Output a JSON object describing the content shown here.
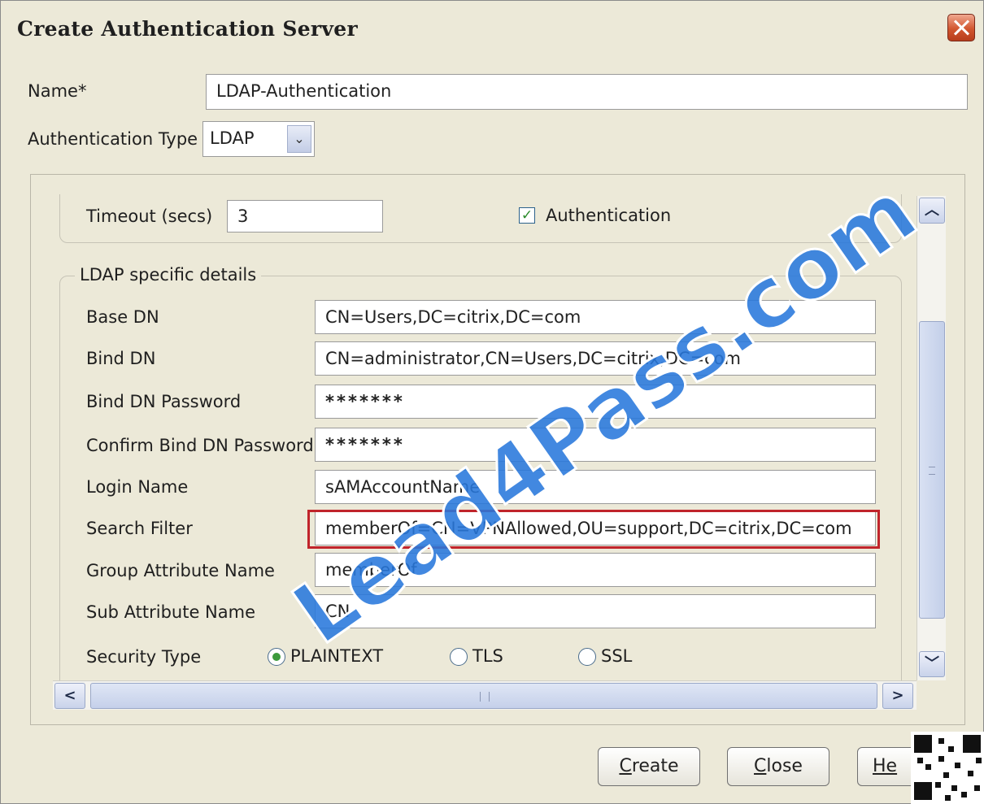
{
  "dialog": {
    "title": "Create Authentication Server"
  },
  "form": {
    "name_label": "Name*",
    "name_value": "LDAP-Authentication",
    "auth_type_label": "Authentication Type",
    "auth_type_value": "LDAP"
  },
  "general": {
    "timeout_label": "Timeout (secs)",
    "timeout_value": "3",
    "authentication_label": "Authentication",
    "authentication_checked": true
  },
  "ldap": {
    "legend": "LDAP specific details",
    "base_dn_label": "Base DN",
    "base_dn_value": "CN=Users,DC=citrix,DC=com",
    "bind_dn_label": "Bind DN",
    "bind_dn_value": "CN=administrator,CN=Users,DC=citrix,DC=com",
    "bind_pwd_label": "Bind DN Password",
    "bind_pwd_value": "*******",
    "confirm_pwd_label": "Confirm Bind DN Password",
    "confirm_pwd_value": "*******",
    "login_name_label": "Login Name",
    "login_name_value": "sAMAccountName",
    "search_filter_label": "Search Filter",
    "search_filter_value": "memberOf=CN=VPNAllowed,OU=support,DC=citrix,DC=com",
    "group_attr_label": "Group Attribute Name",
    "group_attr_value": "memberOf",
    "sub_attr_label": "Sub Attribute Name",
    "sub_attr_value": "CN",
    "security_type_label": "Security Type",
    "security_options": [
      "PLAINTEXT",
      "TLS",
      "SSL"
    ],
    "security_selected": "PLAINTEXT"
  },
  "buttons": {
    "create_mnemonic": "C",
    "create_rest": "reate",
    "close_mnemonic": "C",
    "close_rest": "lose",
    "help_visible": "He"
  },
  "watermark": "Lead4Pass.com",
  "colors": {
    "highlight": "#c0242b",
    "watermark": "#2878dc",
    "dialog_bg": "#ece9d8"
  }
}
